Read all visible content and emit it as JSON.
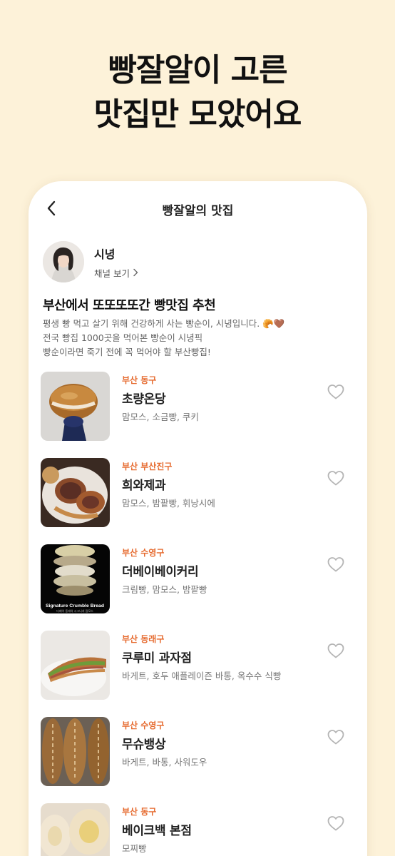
{
  "headline": {
    "line1": "빵잘알이 고른",
    "line2": "맛집만 모았어요"
  },
  "topbar": {
    "title": "빵잘알의 맛집"
  },
  "profile": {
    "name": "시녕",
    "channel_link": "채널 보기"
  },
  "intro": {
    "title": "부산에서 또또또또간 빵맛집 추천",
    "desc_line1": "평생 빵 먹고 살기 위해 건강하게 사는 빵순이, 시녕입니다. 🥐🤎",
    "desc_line2": "전국 빵집 1000곳을 먹어본 빵순이 시녕픽",
    "desc_line3": "빵순이라면 죽기 전에 꼭 먹어야 할 부산빵집!"
  },
  "shops": [
    {
      "region": "부산 동구",
      "name": "초량온당",
      "tags": "맘모스, 소금빵, 쿠키"
    },
    {
      "region": "부산 부산진구",
      "name": "희와제과",
      "tags": "맘모스, 밤팥빵, 휘낭시에"
    },
    {
      "region": "부산 수영구",
      "name": "더베이베이커리",
      "tags": "크림빵, 맘모스, 밤팥빵",
      "thumb_caption": "Signature Crumble Bread",
      "thumb_subcaption": "더베이 동래의 시그니처 맘모스"
    },
    {
      "region": "부산 동래구",
      "name": "쿠루미 과자점",
      "tags": "바게트, 호두 애플레이즌 바통, 옥수수 식빵"
    },
    {
      "region": "부산 수영구",
      "name": "무슈뱅상",
      "tags": "바게트, 바통, 사워도우"
    },
    {
      "region": "부산 동구",
      "name": "베이크백 본점",
      "tags": "모찌빵"
    }
  ],
  "colors": {
    "background": "#fdf2d9",
    "accent_region": "#e66a2e",
    "heart_outline": "#b5b5b5"
  }
}
